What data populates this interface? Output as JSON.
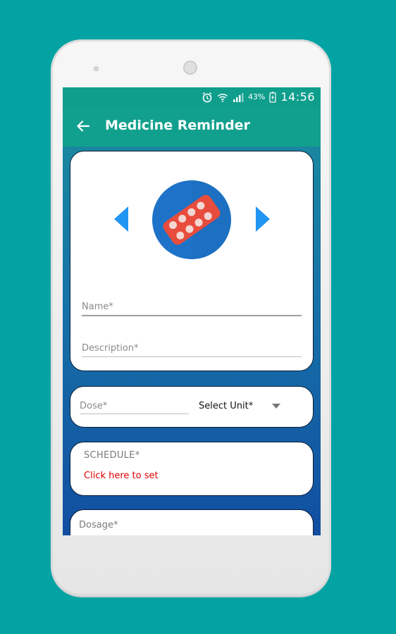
{
  "status_bar": {
    "battery": "43%",
    "time": "14:56",
    "icons": [
      "alarm-icon",
      "wifi-icon",
      "signal-icon",
      "battery-charging-icon"
    ]
  },
  "app_bar": {
    "title": "Medicine Reminder",
    "back_icon": "arrow-left-icon",
    "color": "#12a08e"
  },
  "medicine_card": {
    "icon": "pill-blister-icon",
    "prev_icon": "triangle-left-icon",
    "next_icon": "triangle-right-icon",
    "name_placeholder": "Name*",
    "description_placeholder": "Description*"
  },
  "dose_card": {
    "dose_placeholder": "Dose*",
    "unit_selected": "Select Unit*"
  },
  "schedule_card": {
    "label": "SCHEDULE*",
    "link": "Click here to set",
    "link_color": "#e00000"
  },
  "dosage_card": {
    "label": "Dosage*"
  },
  "colors": {
    "background": "#03a3a3",
    "accent_blue": "#2196f3",
    "pill_red": "#e74c3c"
  }
}
